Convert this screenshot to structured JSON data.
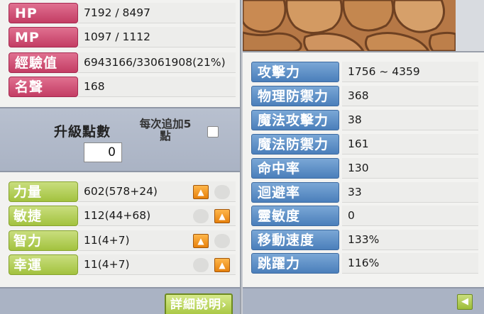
{
  "basic_stats": [
    {
      "label": "HP",
      "value": "7192 / 8497"
    },
    {
      "label": "MP",
      "value": "1097 / 1112"
    },
    {
      "label": "經驗值",
      "value": "6943166/33061908(21%)"
    },
    {
      "label": "名聲",
      "value": "168"
    }
  ],
  "ability_points": {
    "label": "升級點數",
    "value": "0",
    "auto_assign_label": "每次追加5\n點",
    "auto_assign_checked": false
  },
  "primary_stats": [
    {
      "label": "力量",
      "value": "602(578+24)",
      "button_side": "left"
    },
    {
      "label": "敏捷",
      "value": "112(44+68)",
      "button_side": "right"
    },
    {
      "label": "智力",
      "value": "11(4+7)",
      "button_side": "left"
    },
    {
      "label": "幸運",
      "value": "11(4+7)",
      "button_side": "right"
    }
  ],
  "detail_button_label": "詳細說明›",
  "up_icon": "arrow-up-icon",
  "detail_stats": [
    {
      "label": "攻擊力",
      "value": "1756 ~ 4359"
    },
    {
      "label": "物理防禦力",
      "value": "368"
    },
    {
      "label": "魔法攻擊力",
      "value": "38"
    },
    {
      "label": "魔法防禦力",
      "value": "161"
    },
    {
      "label": "命中率",
      "value": "130"
    },
    {
      "label": "迴避率",
      "value": "33"
    },
    {
      "label": "靈敏度",
      "value": "0"
    },
    {
      "label": "移動速度",
      "value": "133%"
    },
    {
      "label": "跳躍力",
      "value": "116%"
    }
  ],
  "collapse_icon": "arrow-left-icon",
  "colors": {
    "basic_label": "#c33d64",
    "stat_label": "#a3c23f",
    "detail_label": "#4b7fbb",
    "up_button": "#e6800c"
  }
}
